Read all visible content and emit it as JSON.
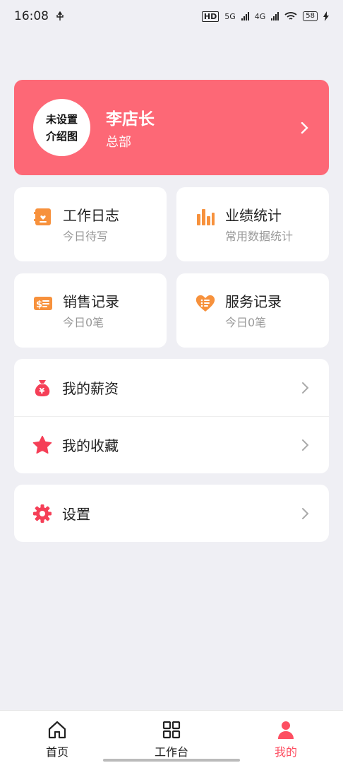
{
  "status_bar": {
    "time": "16:08",
    "usb_icon": "usb-icon",
    "hd_label": "HD",
    "net1": "5G",
    "net2": "4G",
    "battery": "58"
  },
  "profile": {
    "avatar_line1": "未设置",
    "avatar_line2": "介绍图",
    "name": "李店长",
    "department": "总部"
  },
  "tiles": [
    {
      "title": "工作日志",
      "sub": "今日待写",
      "icon": "notebook-icon"
    },
    {
      "title": "业绩统计",
      "sub": "常用数据统计",
      "icon": "bar-chart-icon"
    },
    {
      "title": "销售记录",
      "sub": "今日0笔",
      "icon": "sales-ticket-icon"
    },
    {
      "title": "服务记录",
      "sub": "今日0笔",
      "icon": "heart-list-icon"
    }
  ],
  "menu": {
    "salary": "我的薪资",
    "favorites": "我的收藏",
    "settings": "设置"
  },
  "tabbar": {
    "home": "首页",
    "workbench": "工作台",
    "mine": "我的"
  },
  "colors": {
    "accent": "#fd6876",
    "tile_icon": "#f7913c",
    "menu_icon": "#f53f57",
    "background": "#efeff4"
  }
}
